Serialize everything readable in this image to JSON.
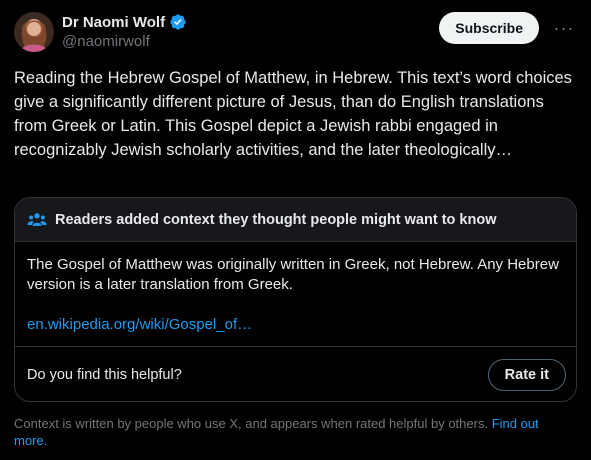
{
  "author": {
    "display_name": "Dr Naomi Wolf",
    "handle": "@naomirwolf",
    "verified_icon": "verified-badge-icon",
    "avatar_icon": "profile-avatar"
  },
  "header": {
    "subscribe_label": "Subscribe",
    "more_icon": "more-options-icon"
  },
  "tweet": {
    "text": "Reading the Hebrew Gospel of Matthew, in Hebrew. This text’s word choices give a significantly different picture of Jesus, than do English translations from Greek or Latin. This Gospel depict a Jewish rabbi engaged in recognizably Jewish scholarly activities, and the later theologically…"
  },
  "community_note": {
    "header_icon": "people-icon",
    "header_text": "Readers added context they thought people might want to know",
    "body_text": "The Gospel of Matthew was originally written in Greek, not Hebrew. Any Hebrew version is a later translation from Greek.",
    "link_text": "en.wikipedia.org/wiki/Gospel_of…",
    "helpful_question": "Do you find this helpful?",
    "rate_label": "Rate it"
  },
  "footer": {
    "context_text": "Context is written by people who use X, and appears when rated helpful by others. ",
    "find_out_more": "Find out more."
  },
  "colors": {
    "background": "#000000",
    "text": "#e7e9ea",
    "muted": "#71767b",
    "link": "#1d9bf0",
    "border": "#2f3336",
    "note_header_bg": "#16181c",
    "verified": "#1d9bf0"
  }
}
